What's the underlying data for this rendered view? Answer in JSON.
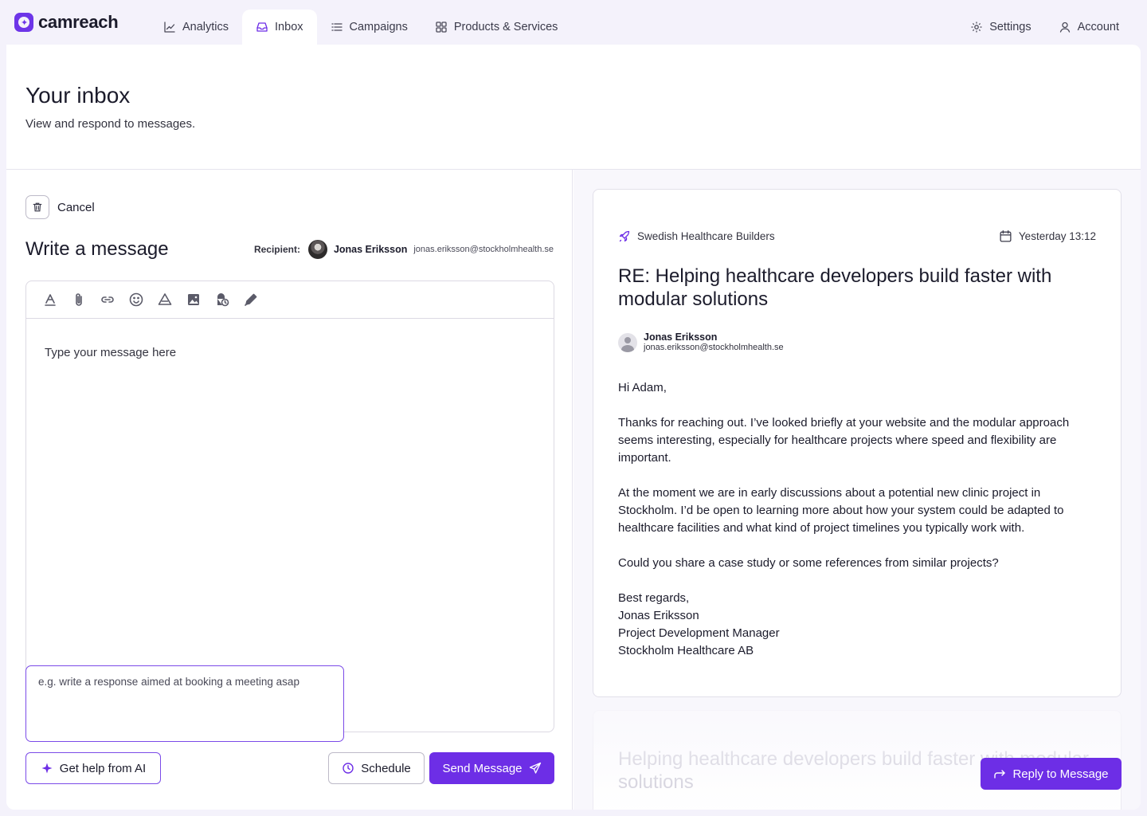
{
  "brand": {
    "name": "camreach",
    "accent": "#6d2ee6"
  },
  "nav": {
    "items": [
      {
        "label": "Analytics",
        "icon": "chart-line-icon"
      },
      {
        "label": "Inbox",
        "icon": "inbox-icon",
        "active": true
      },
      {
        "label": "Campaigns",
        "icon": "list-icon"
      },
      {
        "label": "Products & Services",
        "icon": "grid-icon"
      }
    ],
    "settings_label": "Settings",
    "account_label": "Account"
  },
  "page": {
    "title": "Your inbox",
    "subtitle": "View and respond to messages."
  },
  "compose": {
    "cancel_label": "Cancel",
    "title": "Write a message",
    "recipient_label": "Recipient:",
    "recipient_name": "Jonas Eriksson",
    "recipient_email": "jonas.eriksson@stockholmhealth.se",
    "toolbar_icons": [
      "text-format-icon",
      "paperclip-icon",
      "link-icon",
      "emoji-icon",
      "drive-icon",
      "image-icon",
      "lock-clock-icon",
      "pen-icon"
    ],
    "editor_placeholder": "Type your message here",
    "ai_prompt_placeholder": "e.g. write a response aimed at booking a meeting asap",
    "ai_button_label": "Get help from AI",
    "schedule_label": "Schedule",
    "send_label": "Send Message"
  },
  "message": {
    "campaign": "Swedish Healthcare Builders",
    "timestamp": "Yesterday 13:12",
    "subject": "RE: Helping healthcare developers build faster with modular solutions",
    "sender_name": "Jonas Eriksson",
    "sender_email": "jonas.eriksson@stockholmhealth.se",
    "body": {
      "greeting": "Hi Adam,",
      "p1": "Thanks for reaching out. I’ve looked briefly at your website and the modular approach seems interesting, especially for healthcare projects where speed and flexibility are important.",
      "p2": "At the moment we are in early discussions about a potential new clinic project in Stockholm. I’d be open to learning more about how your system could be adapted to healthcare facilities and what kind of project timelines you typically work with.",
      "p3": "Could you share a case study or some references from similar projects?",
      "sign_off": "Best regards,",
      "sig_name": "Jonas Eriksson",
      "sig_title": "Project Development Manager",
      "sig_company": "Stockholm Healthcare AB"
    }
  },
  "previous_message": {
    "subject": "Helping healthcare developers build faster with modular solutions"
  },
  "reply_label": "Reply to Message"
}
